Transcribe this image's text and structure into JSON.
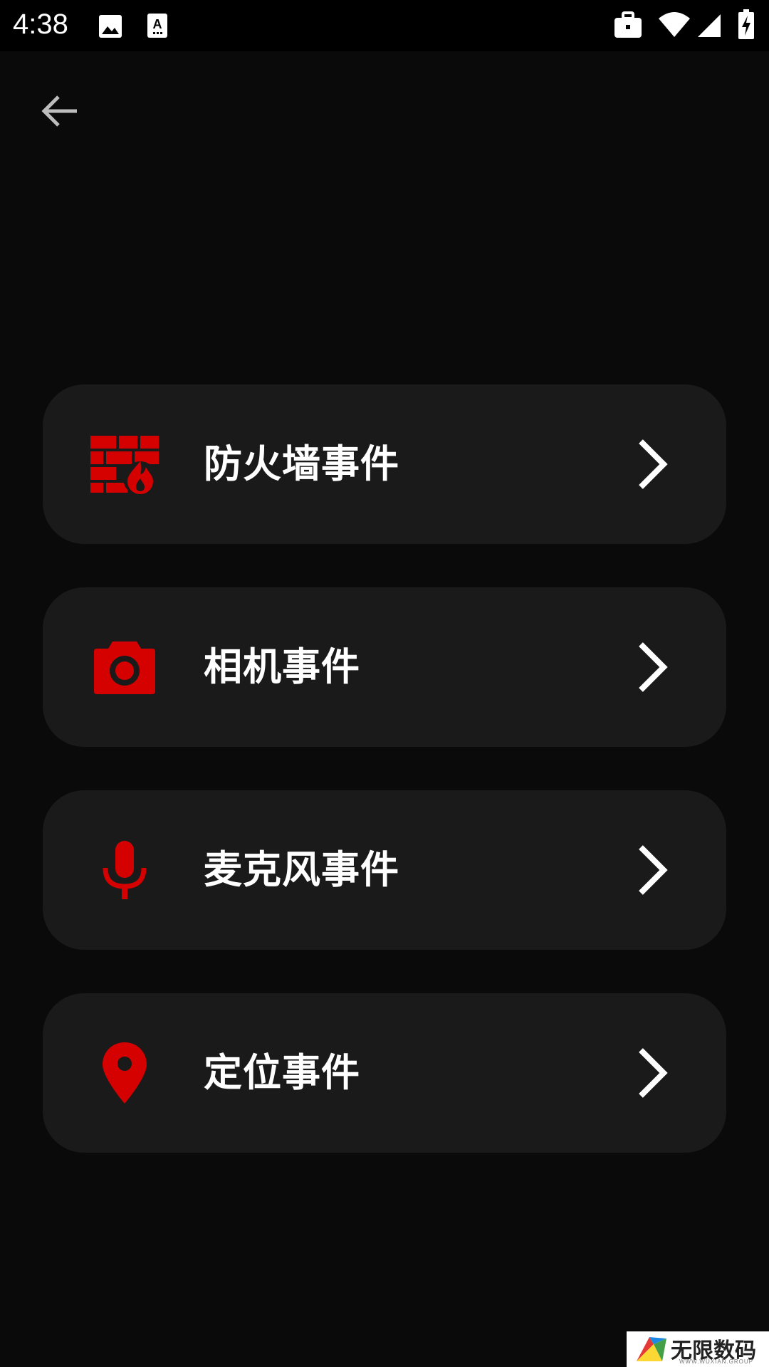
{
  "status_bar": {
    "time": "4:38",
    "left_icons": [
      "image-icon",
      "keyboard-a-icon"
    ],
    "right_icons": [
      "briefcase-icon",
      "wifi-icon",
      "signal-icon",
      "battery-charging-icon"
    ]
  },
  "header": {
    "back_icon": "arrow-left-icon"
  },
  "menu": {
    "accent_color": "#d50000",
    "items": [
      {
        "label": "防火墙事件",
        "icon": "firewall-icon"
      },
      {
        "label": "相机事件",
        "icon": "camera-icon"
      },
      {
        "label": "麦克风事件",
        "icon": "microphone-icon"
      },
      {
        "label": "定位事件",
        "icon": "location-pin-icon"
      }
    ]
  },
  "watermark": {
    "text": "无限数码",
    "sub": "WWW.WUXIAN.GROUP"
  }
}
